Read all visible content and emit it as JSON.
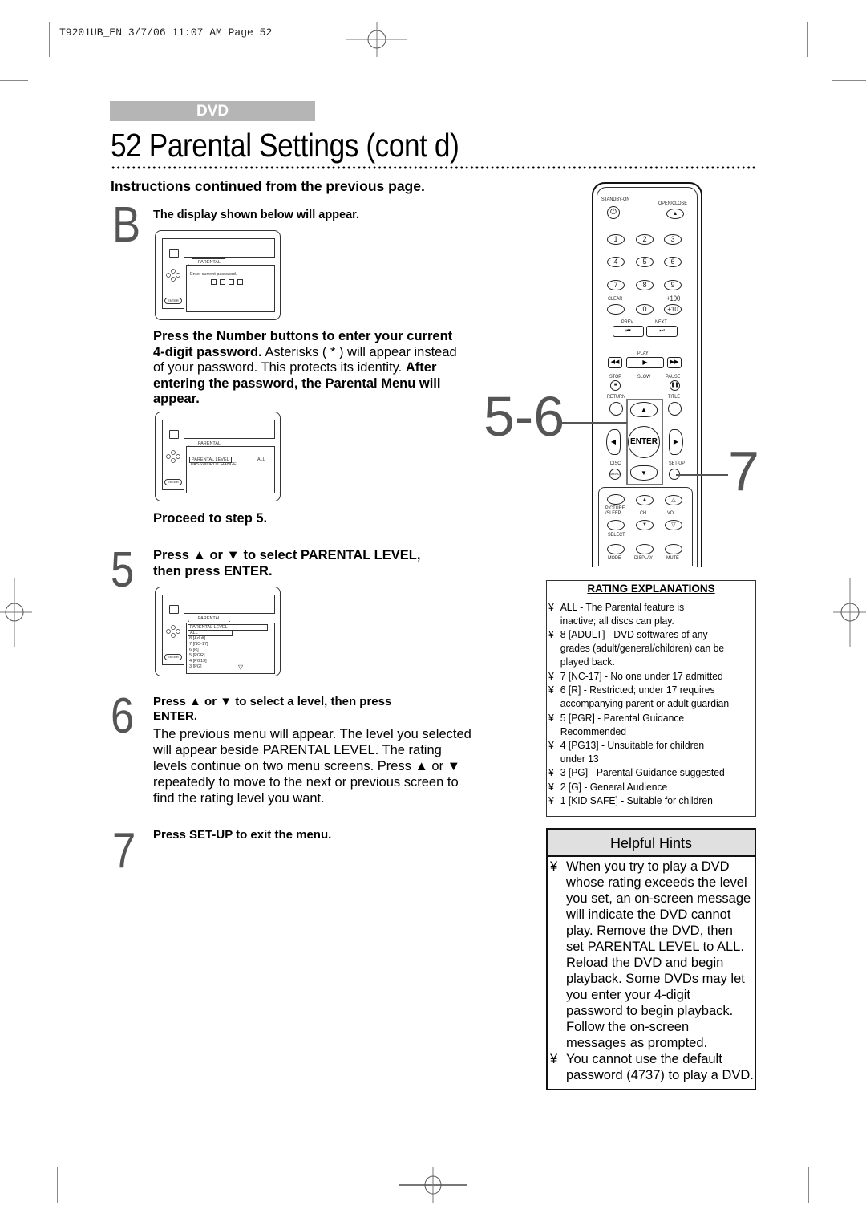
{
  "slug": "T9201UB_EN  3/7/06  11:07 AM  Page 52",
  "section_tag": "DVD",
  "title": "52  Parental Settings (cont d)",
  "subheading": "Instructions continued from the previous page.",
  "steps": {
    "b": {
      "number": "B",
      "heading": "The display shown below will appear.",
      "osd": {
        "tab": "PARENTAL",
        "prompt": "Enter current password.",
        "enter_label": "ENTER"
      },
      "body_line1_bold": "Press the Number buttons to enter your current",
      "body_line2_bold": "4-digit password.",
      "body_line2_plain": " Asterisks ( * ) will appear instead",
      "body_line3_plain": "of your password. This protects its identity.",
      "body_line3_bold": "After",
      "body_line4_bold": "entering the password, the Parental Menu will",
      "body_line5_bold": "appear.",
      "osd2": {
        "tab": "PARENTAL",
        "item1": "PARENTAL LEVEL",
        "item1_value": "ALL",
        "item2": "PASSWORD CHANGE",
        "enter_label": "ENTER"
      },
      "proceed": "Proceed to step 5."
    },
    "s5": {
      "number": "5",
      "line1": "Press ▲ or ▼ to select PARENTAL LEVEL,",
      "line2": "then press ENTER.",
      "osd": {
        "tab": "PARENTAL",
        "header": "PARENTAL LEVEL",
        "levels": [
          "ALL",
          "8 [Adult]",
          "7 [NC-17]",
          "6 [R]",
          "5 [PGR]",
          "4 [PG13]",
          "3 [PG]"
        ],
        "more_indicator": "▽",
        "enter_label": "ENTER"
      }
    },
    "s6": {
      "number": "6",
      "line1": "Press ▲ or ▼ to select a level, then press",
      "line2": "ENTER.",
      "body": [
        "The previous menu will appear. The level you selected",
        "will appear beside PARENTAL LEVEL. The rating",
        "levels continue on two menu screens.  Press ▲ or ▼",
        "repeatedly to move to the next or previous screen to",
        "find the rating level you want."
      ]
    },
    "s7": {
      "number": "7",
      "line1": "Press SET-UP to exit the menu."
    }
  },
  "remote": {
    "labels": {
      "standby": "STANDBY-ON",
      "open_close": "OPEN/CLOSE",
      "clear": "CLEAR",
      "plus100": "+100",
      "plus10": "+10",
      "prev": "PREV",
      "next": "NEXT",
      "play": "PLAY",
      "stop": "STOP",
      "slow": "SLOW",
      "pause": "PAUSE",
      "return": "RETURN",
      "title": "TITLE",
      "enter": "ENTER",
      "disc": "DISC",
      "menu": "MENU",
      "setup": "SET-UP",
      "picture_sleep": "PICTURE /SLEEP",
      "ch": "CH.",
      "vol": "VOL.",
      "select": "SELECT",
      "mode": "MODE",
      "display": "DISPLAY",
      "mute": "MUTE"
    },
    "digits": [
      "1",
      "2",
      "3",
      "4",
      "5",
      "6",
      "7",
      "8",
      "9",
      "0"
    ],
    "callout_56": "5-6",
    "callout_7": "7"
  },
  "rating_explanations": {
    "heading": "RATING EXPLANATIONS",
    "bullet": "¥",
    "items": [
      {
        "lines": [
          "ALL - The Parental feature is",
          "inactive; all discs can play."
        ]
      },
      {
        "lines": [
          "8 [ADULT] - DVD softwares of any",
          "grades (adult/general/children) can be",
          "played back."
        ]
      },
      {
        "lines": [
          "7 [NC-17] - No one under 17 admitted"
        ]
      },
      {
        "lines": [
          "6 [R] - Restricted; under 17 requires",
          "accompanying parent or adult guardian"
        ]
      },
      {
        "lines": [
          "5 [PGR] - Parental Guidance",
          "Recommended"
        ]
      },
      {
        "lines": [
          "4 [PG13] - Unsuitable for children",
          "under 13"
        ]
      },
      {
        "lines": [
          "3 [PG] - Parental Guidance suggested"
        ]
      },
      {
        "lines": [
          "2 [G] - General Audience"
        ]
      },
      {
        "lines": [
          "1 [KID SAFE] - Suitable for children"
        ]
      }
    ]
  },
  "helpful_hints": {
    "heading": "Helpful Hints",
    "bullet": "¥",
    "items": [
      {
        "lines": [
          "When you try to play a DVD",
          "whose rating exceeds the level",
          "you set, an on-screen message",
          "will indicate the DVD cannot",
          "play. Remove the DVD, then",
          "set PARENTAL LEVEL to ALL.",
          "Reload the DVD and begin",
          "playback. Some DVDs may let",
          "you enter your 4-digit",
          "password to begin playback.",
          "Follow the on-screen",
          "messages as prompted."
        ]
      },
      {
        "lines": [
          "You cannot use the default",
          "password (4737) to play a DVD."
        ]
      }
    ]
  }
}
